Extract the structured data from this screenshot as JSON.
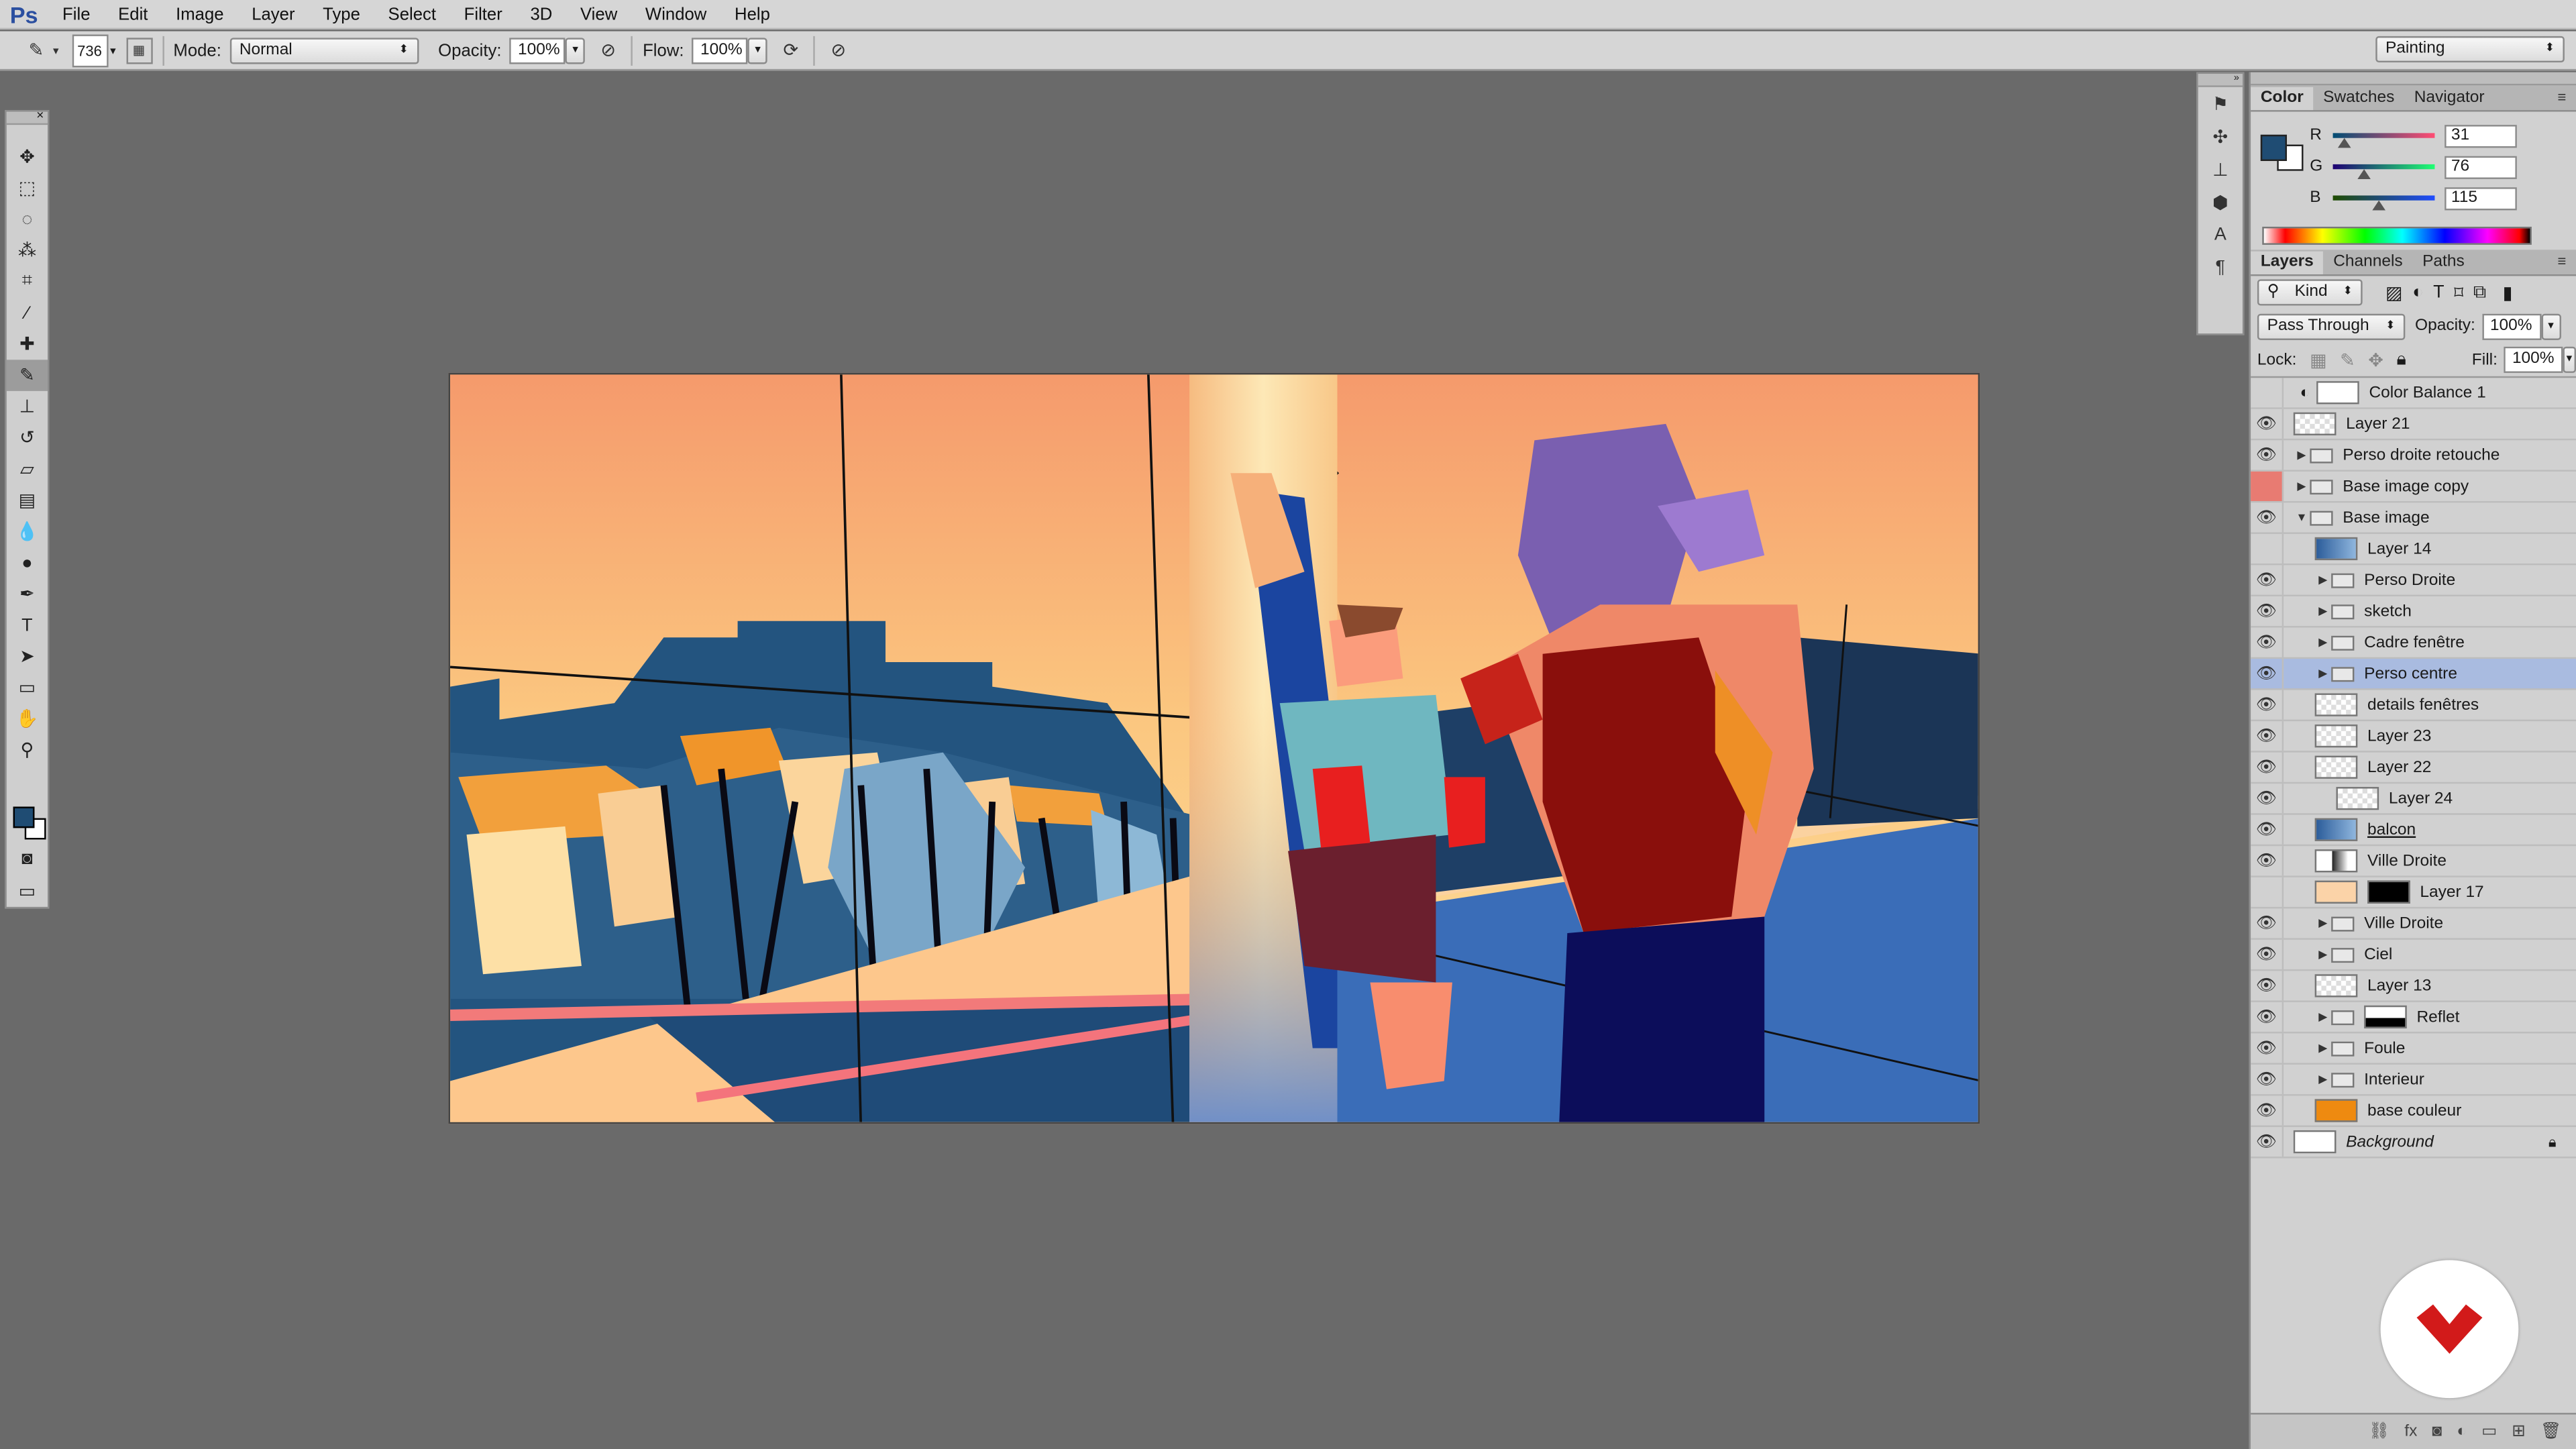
{
  "app": {
    "logo": "Ps"
  },
  "menu": [
    "File",
    "Edit",
    "Image",
    "Layer",
    "Type",
    "Select",
    "Filter",
    "3D",
    "View",
    "Window",
    "Help"
  ],
  "options": {
    "brush_size": "736",
    "mode_label": "Mode:",
    "mode_value": "Normal",
    "opacity_label": "Opacity:",
    "opacity_value": "100%",
    "flow_label": "Flow:",
    "flow_value": "100%",
    "workspace": "Painting"
  },
  "color_panel": {
    "tabs": [
      "Color",
      "Swatches",
      "Navigator"
    ],
    "channels": [
      {
        "label": "R",
        "value": "31",
        "fraction": 0.12
      },
      {
        "label": "G",
        "value": "76",
        "fraction": 0.3
      },
      {
        "label": "B",
        "value": "115",
        "fraction": 0.45
      }
    ],
    "foreground": "#1f4c73",
    "background": "#ffffff"
  },
  "layers_panel": {
    "tabs": [
      "Layers",
      "Channels",
      "Paths"
    ],
    "kind_label": "Kind",
    "blend_mode": "Pass Through",
    "opacity_label": "Opacity:",
    "opacity_value": "100%",
    "lock_label": "Lock:",
    "fill_label": "Fill:",
    "fill_value": "100%",
    "layers": [
      {
        "name": "Color Balance 1",
        "visible": false,
        "type": "adjustment",
        "indent": 0
      },
      {
        "name": "Layer 21",
        "visible": true,
        "type": "layer",
        "indent": 0
      },
      {
        "name": "Perso droite retouche",
        "visible": true,
        "type": "group",
        "indent": 0
      },
      {
        "name": "Base image copy",
        "visible": false,
        "type": "group",
        "indent": 0,
        "eye_red": true
      },
      {
        "name": "Base image",
        "visible": true,
        "type": "group-open",
        "indent": 0
      },
      {
        "name": "Layer 14",
        "visible": false,
        "type": "layer-blue",
        "indent": 1
      },
      {
        "name": "Perso Droite",
        "visible": true,
        "type": "group",
        "indent": 1
      },
      {
        "name": "sketch",
        "visible": true,
        "type": "group",
        "indent": 1
      },
      {
        "name": "Cadre fenêtre",
        "visible": true,
        "type": "group",
        "indent": 1
      },
      {
        "name": "Perso centre",
        "visible": true,
        "type": "group",
        "indent": 1,
        "selected": true
      },
      {
        "name": "details fenêtres",
        "visible": true,
        "type": "layer",
        "indent": 1
      },
      {
        "name": "Layer 23",
        "visible": true,
        "type": "layer",
        "indent": 1
      },
      {
        "name": "Layer 22",
        "visible": true,
        "type": "layer",
        "indent": 1
      },
      {
        "name": "Layer 24",
        "visible": true,
        "type": "layer",
        "indent": 2
      },
      {
        "name": "balcon",
        "visible": true,
        "type": "layer-blue",
        "indent": 1,
        "underline": true
      },
      {
        "name": "Ville Droite",
        "visible": true,
        "type": "layer-dark",
        "indent": 1
      },
      {
        "name": "Layer 17",
        "visible": false,
        "type": "layer-mask",
        "indent": 1
      },
      {
        "name": "Ville Droite",
        "visible": true,
        "type": "group",
        "indent": 1
      },
      {
        "name": "Ciel",
        "visible": true,
        "type": "group",
        "indent": 1
      },
      {
        "name": "Layer 13",
        "visible": true,
        "type": "layer",
        "indent": 1
      },
      {
        "name": "Reflet",
        "visible": true,
        "type": "group-mask",
        "indent": 1
      },
      {
        "name": "Foule",
        "visible": true,
        "type": "group",
        "indent": 1
      },
      {
        "name": "Interieur",
        "visible": true,
        "type": "group",
        "indent": 1
      },
      {
        "name": "base couleur",
        "visible": true,
        "type": "layer-orange",
        "indent": 1
      },
      {
        "name": "Background",
        "visible": true,
        "type": "background",
        "indent": 0
      }
    ]
  }
}
